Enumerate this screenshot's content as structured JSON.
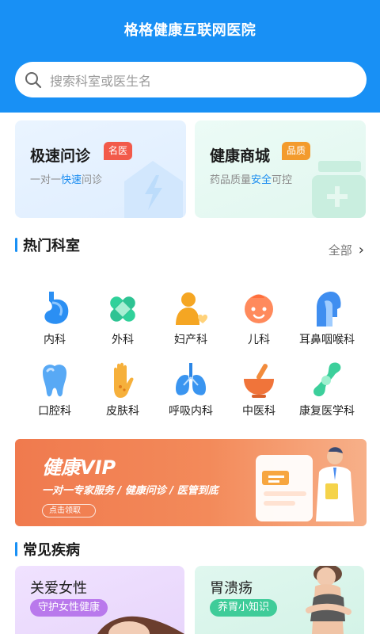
{
  "app": {
    "title": "格格健康互联网医院"
  },
  "search": {
    "placeholder": "搜索科室或医生名"
  },
  "services": [
    {
      "title": "极速问诊",
      "badge": "名医",
      "sub_pre": "一对一",
      "sub_hl": "快速",
      "sub_post": "问诊"
    },
    {
      "title": "健康商城",
      "badge": "品质",
      "sub_pre": "药品质量",
      "sub_hl": "安全",
      "sub_post": "可控"
    }
  ],
  "departments_section": {
    "title": "热门科室",
    "see_all": "全部"
  },
  "departments": [
    {
      "label": "内科",
      "icon": "stomach-icon"
    },
    {
      "label": "外科",
      "icon": "bandage-icon"
    },
    {
      "label": "妇产科",
      "icon": "mother-baby-icon"
    },
    {
      "label": "儿科",
      "icon": "child-face-icon"
    },
    {
      "label": "耳鼻咽喉科",
      "icon": "throat-icon"
    },
    {
      "label": "口腔科",
      "icon": "tooth-icon"
    },
    {
      "label": "皮肤科",
      "icon": "hand-skin-icon"
    },
    {
      "label": "呼吸内科",
      "icon": "lungs-icon"
    },
    {
      "label": "中医科",
      "icon": "mortar-icon"
    },
    {
      "label": "康复医学科",
      "icon": "bone-joint-icon"
    }
  ],
  "banner": {
    "title": "健康VIP",
    "subtitle": "一对一专家服务 / 健康问诊 / 医管到底",
    "button": "点击领取"
  },
  "diseases_section": {
    "title": "常见疾病"
  },
  "diseases": [
    {
      "title": "关爱女性",
      "tag": "守护女性健康"
    },
    {
      "title": "胃溃疡",
      "tag": "养胃小知识"
    }
  ],
  "colors": {
    "primary": "#1890f5",
    "badge_red": "#f25a4a",
    "badge_orange": "#f39b2d",
    "banner": "#f07a4e"
  }
}
